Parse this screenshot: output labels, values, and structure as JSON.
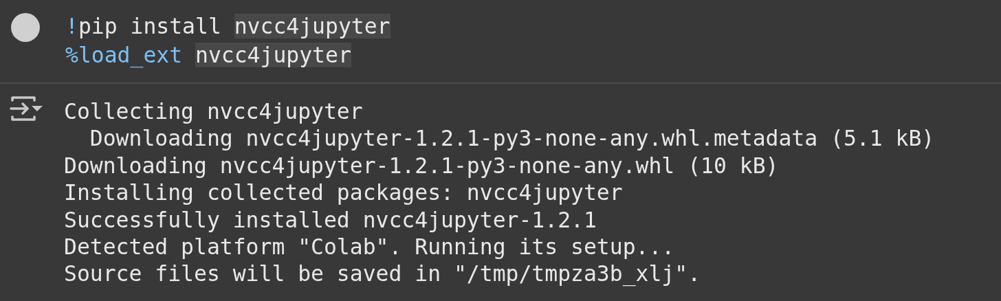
{
  "code_cell": {
    "lines": [
      [
        {
          "text": "!",
          "kind": "magic"
        },
        {
          "text": "pip install ",
          "kind": "plain"
        },
        {
          "text": "nvcc4jupyter",
          "kind": "match"
        }
      ],
      [
        {
          "text": "%load_ext ",
          "kind": "magic"
        },
        {
          "text": "nvcc4jupyter",
          "kind": "match"
        }
      ]
    ]
  },
  "output": {
    "lines": [
      "Collecting nvcc4jupyter",
      "  Downloading nvcc4jupyter-1.2.1-py3-none-any.whl.metadata (5.1 kB)",
      "Downloading nvcc4jupyter-1.2.1-py3-none-any.whl (10 kB)",
      "Installing collected packages: nvcc4jupyter",
      "Successfully installed nvcc4jupyter-1.2.1",
      "Detected platform \"Colab\". Running its setup...",
      "Source files will be saved in \"/tmp/tmpza3b_xlj\"."
    ]
  }
}
